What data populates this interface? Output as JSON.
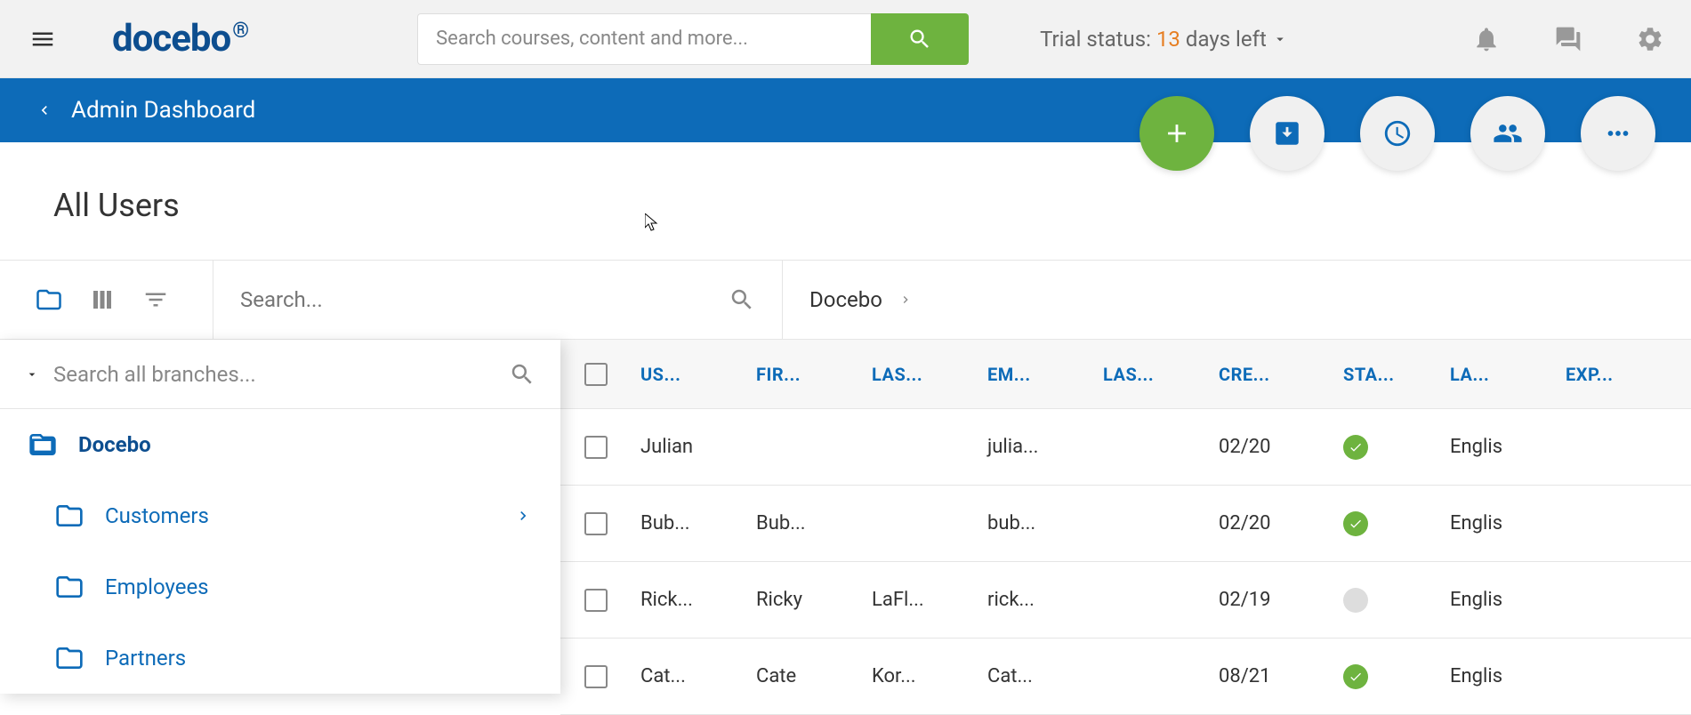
{
  "header": {
    "logo_text": "docebo",
    "search_placeholder": "Search courses, content and more...",
    "trial_prefix": "Trial status:",
    "trial_days": "13",
    "trial_suffix": "days left"
  },
  "bluebar": {
    "back_label": "Admin Dashboard"
  },
  "page": {
    "title": "All Users"
  },
  "toolbar": {
    "search_placeholder": "Search..."
  },
  "breadcrumb": {
    "root": "Docebo"
  },
  "branch_panel": {
    "search_placeholder": "Search all branches...",
    "root": "Docebo",
    "children": [
      "Customers",
      "Employees",
      "Partners"
    ]
  },
  "table": {
    "headers": [
      "US...",
      "FIR...",
      "LAS...",
      "EM...",
      "LAS...",
      "CRE...",
      "STA...",
      "LA...",
      "EXP..."
    ],
    "rows": [
      {
        "user": "Julian",
        "first": "",
        "last": "",
        "email": "julia...",
        "last2": "",
        "created": "02/20",
        "status": "green",
        "lang": "Englis",
        "exp": ""
      },
      {
        "user": "Bub...",
        "first": "Bub...",
        "last": "",
        "email": "bub...",
        "last2": "",
        "created": "02/20",
        "status": "green",
        "lang": "Englis",
        "exp": ""
      },
      {
        "user": "Rick...",
        "first": "Ricky",
        "last": "LaFl...",
        "email": "rick...",
        "last2": "",
        "created": "02/19",
        "status": "gray",
        "lang": "Englis",
        "exp": ""
      },
      {
        "user": "Cat...",
        "first": "Cate",
        "last": "Kor...",
        "email": "Cat...",
        "last2": "",
        "created": "08/21",
        "status": "green",
        "lang": "Englis",
        "exp": ""
      }
    ]
  }
}
